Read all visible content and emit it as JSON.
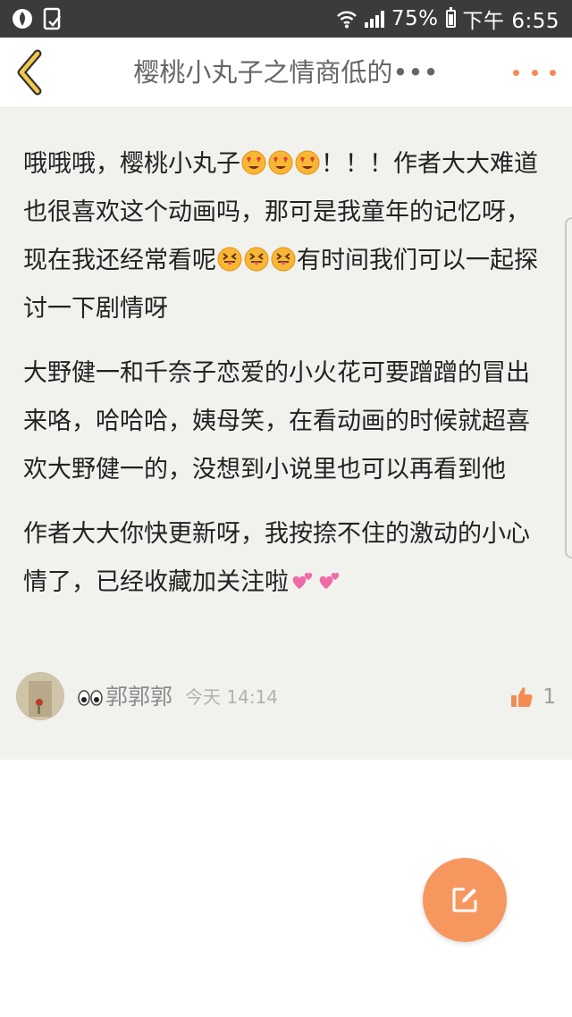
{
  "status_bar": {
    "battery": "75%",
    "time": "下午 6:55"
  },
  "header": {
    "title": "樱桃小丸子之情商低的•••"
  },
  "post": {
    "p1_a": "哦哦哦，樱桃小丸子",
    "p1_b": "！！！作者大大难道也很喜欢这个动画吗，那可是我童年的记忆呀，现在我还经常看呢",
    "p1_c": "有时间我们可以一起探讨一下剧情呀",
    "p2": "大野健一和千奈子恋爱的小火花可要蹭蹭的冒出来咯，哈哈哈，姨母笑，在看动画的时候就超喜欢大野健一的，没想到小说里也可以再看到他",
    "p3": "作者大大你快更新呀，我按捺不住的激动的小心情了，已经收藏加关注啦"
  },
  "author": {
    "name": "郭郭郭",
    "time": "今天 14:14",
    "likes": "1"
  },
  "colors": {
    "accent": "#f79760",
    "card_bg": "#f1f2ed",
    "status_bar": "#3b3b3b"
  },
  "icons": {
    "back": "chevron-left-icon",
    "more": "more-dots-icon",
    "heart_eyes": "heart-eyes-emoji",
    "tongue": "squinting-tongue-emoji",
    "hearts": "two-hearts-emoji",
    "like": "thumbs-up-icon",
    "edit": "edit-icon"
  }
}
